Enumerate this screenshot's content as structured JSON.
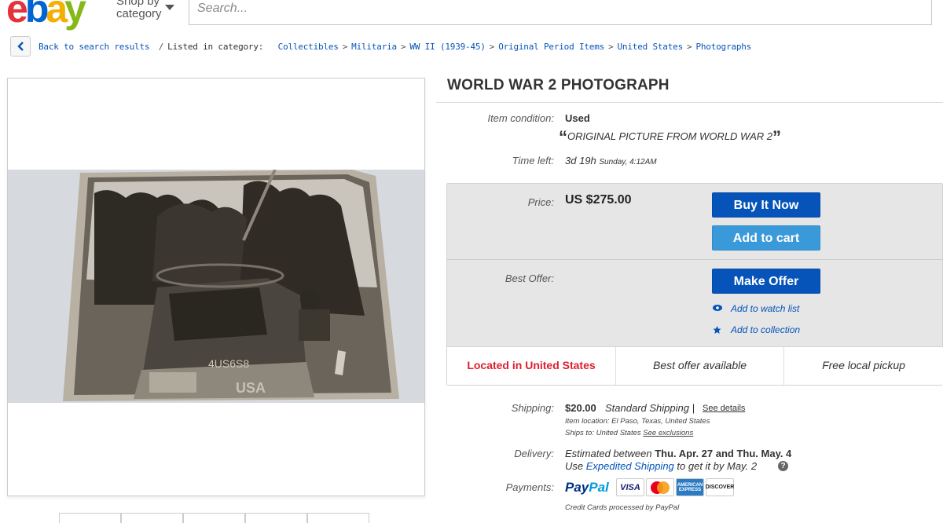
{
  "header": {
    "logo": {
      "e": "e",
      "b": "b",
      "a": "a",
      "y": "y"
    },
    "shop_by": "Shop by",
    "shop_by_2": "category",
    "search_placeholder": "Search..."
  },
  "breadcrumb": {
    "back_label": "Back to search results",
    "listed_in": "Listed in category:",
    "items": [
      "Collectibles",
      "Militaria",
      "WW II (1939-45)",
      "Original Period Items",
      "United States",
      "Photographs"
    ],
    "separator": ">",
    "divider": "/"
  },
  "item": {
    "title": "WORLD WAR 2 PHOTOGRAPH",
    "condition_label": "Item condition:",
    "condition_value": "Used",
    "condition_desc": "ORIGINAL PICTURE FROM WORLD WAR 2",
    "time_label": "Time left:",
    "time_value": "3d 19h",
    "time_detail": "Sunday, 4:12AM",
    "price_label": "Price:",
    "price_value": "US $275.00",
    "buy_now": "Buy It Now",
    "add_to_cart": "Add to cart",
    "best_offer_label": "Best Offer:",
    "make_offer": "Make Offer",
    "watch_list": "Add to watch list",
    "collection": "Add to collection",
    "badges": [
      "Located in United States",
      "Best offer available",
      "Free local pickup"
    ]
  },
  "shipping": {
    "label": "Shipping:",
    "price": "$20.00",
    "method": "Standard Shipping |",
    "see_details": "See details",
    "location_label": "Item location:",
    "location": "El Paso, Texas, United States",
    "ships_to_label": "Ships to:",
    "ships_to": "United States",
    "see_exclusions": "See exclusions"
  },
  "delivery": {
    "label": "Delivery:",
    "estimated": "Estimated between",
    "date_range": "Thu. Apr. 27 and Thu. May. 4",
    "use": "Use",
    "expedited": "Expedited Shipping",
    "by": "to get it by May. 2",
    "help": "?"
  },
  "payments": {
    "label": "Payments:",
    "paypal_1": "Pay",
    "paypal_2": "Pal",
    "cards": [
      "VISA",
      "MasterCard",
      "AMERICAN EXPRESS",
      "DISCOVER"
    ],
    "note": "Credit Cards processed by PayPal"
  },
  "colors": {
    "brand_blue": "#0654ba",
    "cart_blue": "#3a9ad9",
    "location_red": "#dd1e31"
  }
}
